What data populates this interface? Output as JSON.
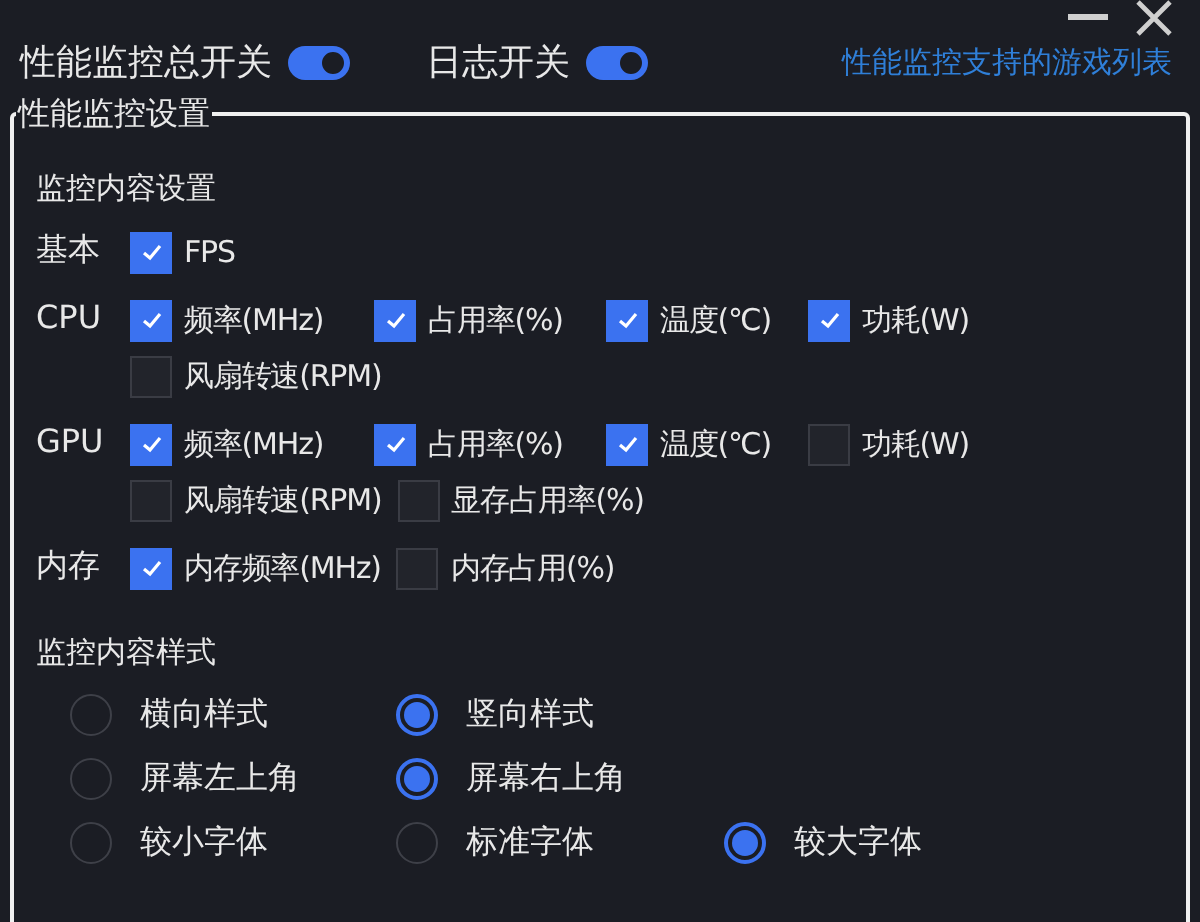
{
  "switches": [
    {
      "label": "性能监控总开关",
      "on": true
    },
    {
      "label": "日志开关",
      "on": true
    }
  ],
  "game_list_link": "性能监控支持的游戏列表",
  "settings": {
    "title": "性能监控设置",
    "content_title": "监控内容设置",
    "groups": [
      {
        "label": "基本",
        "options": [
          {
            "label": "FPS",
            "checked": true
          }
        ]
      },
      {
        "label": "CPU",
        "options": [
          {
            "label": "频率(MHz)",
            "checked": true
          },
          {
            "label": "占用率(%)",
            "checked": true
          },
          {
            "label": "温度(℃)",
            "checked": true
          },
          {
            "label": "功耗(W)",
            "checked": true
          },
          {
            "label": "风扇转速(RPM)",
            "checked": false
          }
        ]
      },
      {
        "label": "GPU",
        "options": [
          {
            "label": "频率(MHz)",
            "checked": true
          },
          {
            "label": "占用率(%)",
            "checked": true
          },
          {
            "label": "温度(℃)",
            "checked": true
          },
          {
            "label": "功耗(W)",
            "checked": false
          },
          {
            "label": "风扇转速(RPM)",
            "checked": false
          },
          {
            "label": "显存占用率(%)",
            "checked": false
          }
        ]
      },
      {
        "label": "内存",
        "options": [
          {
            "label": "内存频率(MHz)",
            "checked": true
          },
          {
            "label": "内存占用(%)",
            "checked": false
          }
        ]
      }
    ],
    "style_title": "监控内容样式",
    "style_rows": [
      [
        {
          "label": "横向样式",
          "selected": false
        },
        {
          "label": "竖向样式",
          "selected": true
        }
      ],
      [
        {
          "label": "屏幕左上角",
          "selected": false
        },
        {
          "label": "屏幕右上角",
          "selected": true
        }
      ],
      [
        {
          "label": "较小字体",
          "selected": false
        },
        {
          "label": "标准字体",
          "selected": false
        },
        {
          "label": "较大字体",
          "selected": true
        }
      ]
    ]
  }
}
